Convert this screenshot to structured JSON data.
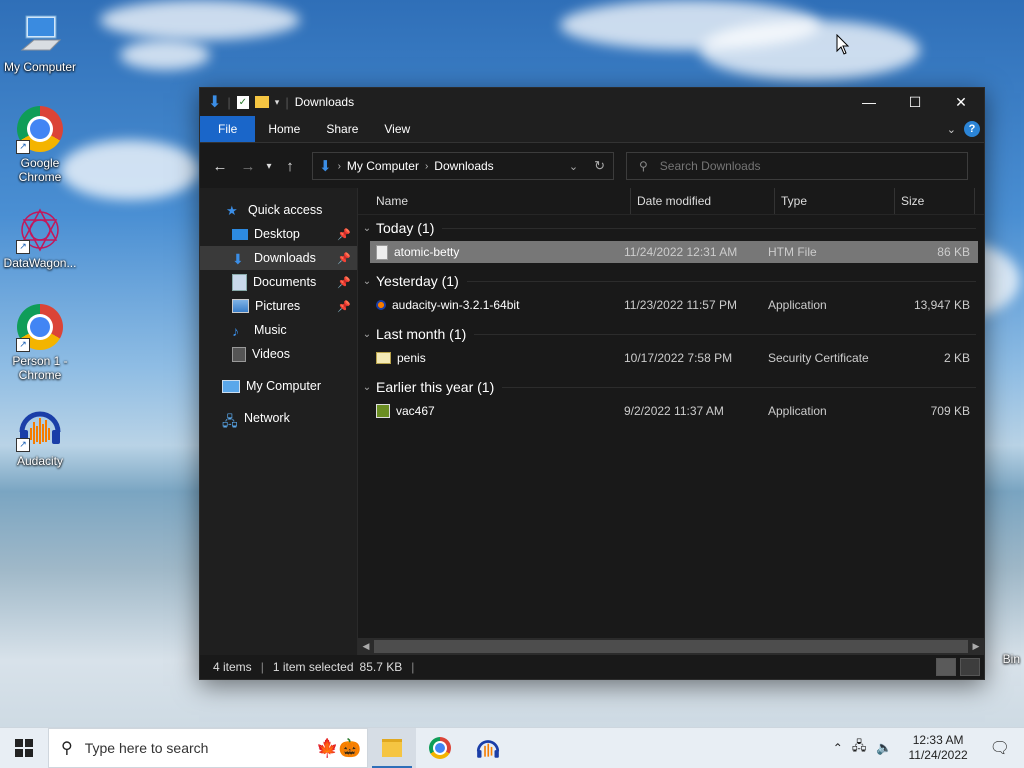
{
  "desktop": {
    "icons": [
      {
        "label": "My Computer"
      },
      {
        "label": "Google Chrome"
      },
      {
        "label": "DataWagon..."
      },
      {
        "label": "Person 1 - Chrome"
      },
      {
        "label": "Audacity"
      },
      {
        "label": "Bin"
      }
    ]
  },
  "window": {
    "title": "Downloads",
    "ribbon_tabs": [
      "File",
      "Home",
      "Share",
      "View"
    ],
    "address": {
      "crumbs": [
        "My Computer",
        "Downloads"
      ]
    },
    "search_placeholder": "Search Downloads",
    "sidebar": {
      "quick_access": "Quick access",
      "items": [
        {
          "label": "Desktop",
          "pinned": true
        },
        {
          "label": "Downloads",
          "pinned": true
        },
        {
          "label": "Documents",
          "pinned": true
        },
        {
          "label": "Pictures",
          "pinned": true
        },
        {
          "label": "Music",
          "pinned": false
        },
        {
          "label": "Videos",
          "pinned": false
        }
      ],
      "my_computer": "My Computer",
      "network": "Network"
    },
    "columns": {
      "name": "Name",
      "date": "Date modified",
      "type": "Type",
      "size": "Size"
    },
    "groups": [
      {
        "title": "Today (1)",
        "files": [
          {
            "name": "atomic-betty",
            "date": "11/24/2022 12:31 AM",
            "type": "HTM File",
            "size": "86 KB",
            "selected": true
          }
        ]
      },
      {
        "title": "Yesterday (1)",
        "files": [
          {
            "name": "audacity-win-3.2.1-64bit",
            "date": "11/23/2022 11:57 PM",
            "type": "Application",
            "size": "13,947 KB"
          }
        ]
      },
      {
        "title": "Last month (1)",
        "files": [
          {
            "name": "penis",
            "date": "10/17/2022 7:58 PM",
            "type": "Security Certificate",
            "size": "2 KB"
          }
        ]
      },
      {
        "title": "Earlier this year (1)",
        "files": [
          {
            "name": "vac467",
            "date": "9/2/2022 11:37 AM",
            "type": "Application",
            "size": "709 KB"
          }
        ]
      }
    ],
    "status": {
      "count": "4 items",
      "selected": "1 item selected",
      "size": "85.7 KB"
    }
  },
  "taskbar": {
    "search_placeholder": "Type here to search",
    "clock_time": "12:33 AM",
    "clock_date": "11/24/2022"
  }
}
